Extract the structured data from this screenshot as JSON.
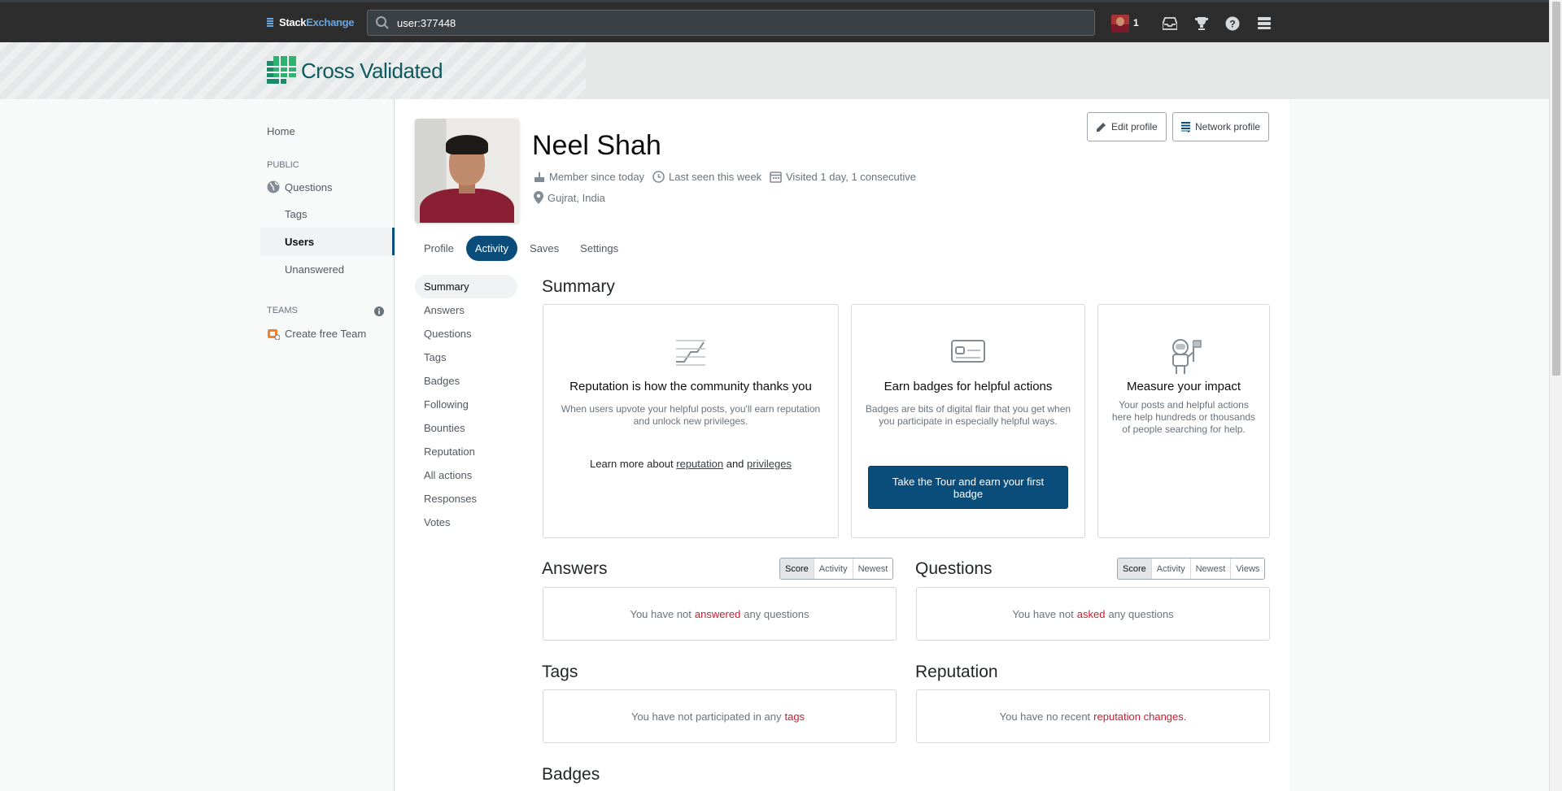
{
  "topbar": {
    "brand_stack": "Stack",
    "brand_exchange": "Exchange",
    "search_value": "user:377448",
    "reputation": "1",
    "icons": [
      "inbox-icon",
      "achievements-icon",
      "help-icon",
      "site-switcher-icon"
    ]
  },
  "site": {
    "name": "Cross Validated"
  },
  "leftnav": {
    "home": "Home",
    "public_heading": "PUBLIC",
    "questions": "Questions",
    "tags": "Tags",
    "users": "Users",
    "unanswered": "Unanswered",
    "teams_heading": "TEAMS",
    "create_team": "Create free Team"
  },
  "profile": {
    "name": "Neel Shah",
    "member_since": "Member since today",
    "last_seen": "Last seen this week",
    "visited": "Visited 1 day, 1 consecutive",
    "location": "Gujrat, India",
    "edit_profile": "Edit profile",
    "network_profile": "Network profile"
  },
  "tabs": [
    "Profile",
    "Activity",
    "Saves",
    "Settings"
  ],
  "active_tab": "Activity",
  "subnav": [
    "Summary",
    "Answers",
    "Questions",
    "Tags",
    "Badges",
    "Following",
    "Bounties",
    "Reputation",
    "All actions",
    "Responses",
    "Votes"
  ],
  "summary": {
    "heading": "Summary",
    "rep_card": {
      "title": "Reputation is how the community thanks you",
      "desc": "When users upvote your helpful posts, you'll earn reputation and unlock new privileges.",
      "learn_prefix": "Learn more about",
      "reputation_link": "reputation",
      "and": "and",
      "privileges_link": "privileges"
    },
    "badge_card": {
      "title": "Earn badges for helpful actions",
      "desc": "Badges are bits of digital flair that you get when you participate in especially helpful ways.",
      "button": "Take the Tour and earn your first badge"
    },
    "impact_card": {
      "title": "Measure your impact",
      "desc": "Your posts and helpful actions here help hundreds or thousands of people searching for help."
    }
  },
  "answers": {
    "heading": "Answers",
    "sort": [
      "Score",
      "Activity",
      "Newest"
    ],
    "empty_pre": "You have not",
    "empty_link": "answered",
    "empty_post": "any questions"
  },
  "questions": {
    "heading": "Questions",
    "sort": [
      "Score",
      "Activity",
      "Newest",
      "Views"
    ],
    "empty_pre": "You have not",
    "empty_link": "asked",
    "empty_post": "any questions"
  },
  "tags": {
    "heading": "Tags",
    "empty_pre": "You have not participated in any",
    "empty_link": "tags"
  },
  "reputation": {
    "heading": "Reputation",
    "empty_pre": "You have no recent",
    "empty_link": "reputation changes",
    "empty_post": "."
  },
  "badges": {
    "heading": "Badges"
  },
  "colors": {
    "accent": "#0a4d7a",
    "topbar": "#2d2d2d",
    "link_red": "#c91d2e",
    "site_teal": "#0c5a5f"
  }
}
